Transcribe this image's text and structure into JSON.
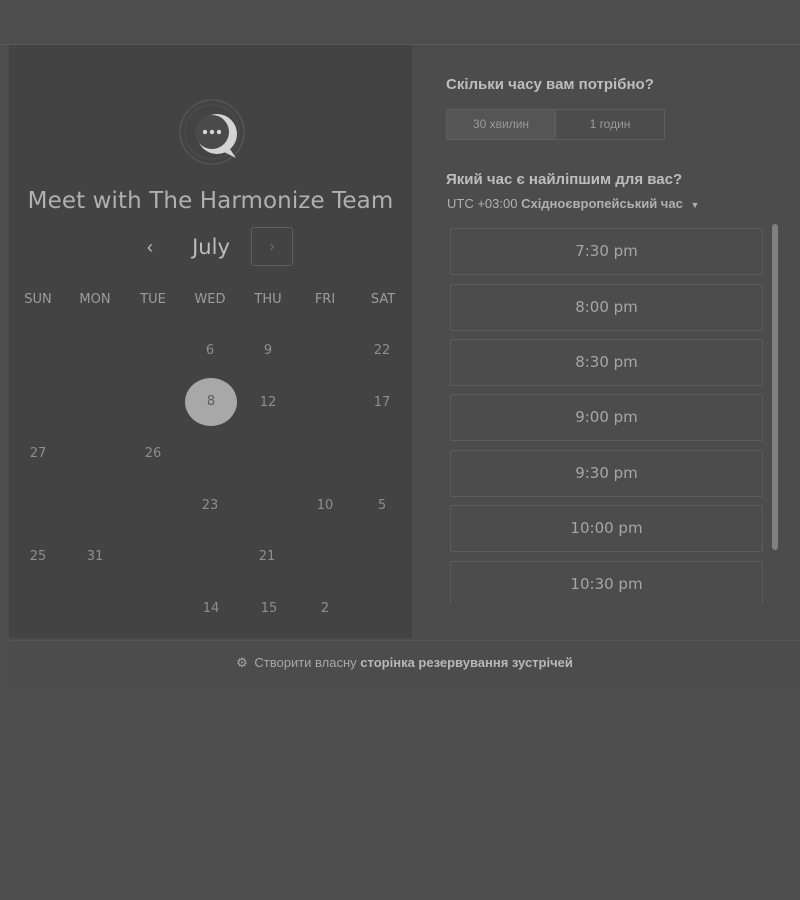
{
  "header": {
    "title": "Meet with The Harmonize Team",
    "logo_icon": "chat-bubble-logo-icon"
  },
  "calendar": {
    "month": "July",
    "prev_label": "‹",
    "next_label": "›",
    "weekdays": [
      "SUN",
      "MON",
      "TUE",
      "WED",
      "THU",
      "FRI",
      "SAT"
    ],
    "days": [
      "6",
      "9",
      "22",
      "12",
      "17",
      "27",
      "26",
      "23",
      "10",
      "5",
      "25",
      "31",
      "21",
      "14",
      "15",
      "2"
    ],
    "selected_day": "8"
  },
  "duration": {
    "label": "Скільки часу вам потрібно?",
    "options": [
      "30 хвилин",
      "1 годин"
    ],
    "selected": "30 хвилин"
  },
  "time": {
    "label": "Який час є найліпшим для вас?",
    "timezone_offset": "UTC +03:00",
    "timezone_name": "Східноєвропейський час",
    "slots": [
      "7:30 pm",
      "8:00 pm",
      "8:30 pm",
      "9:00 pm",
      "9:30 pm",
      "10:00 pm",
      "10:30 pm"
    ]
  },
  "footer": {
    "prefix": "Створити власну",
    "link": "сторінка резервування зустрічей",
    "icon": "sprocket-icon"
  }
}
